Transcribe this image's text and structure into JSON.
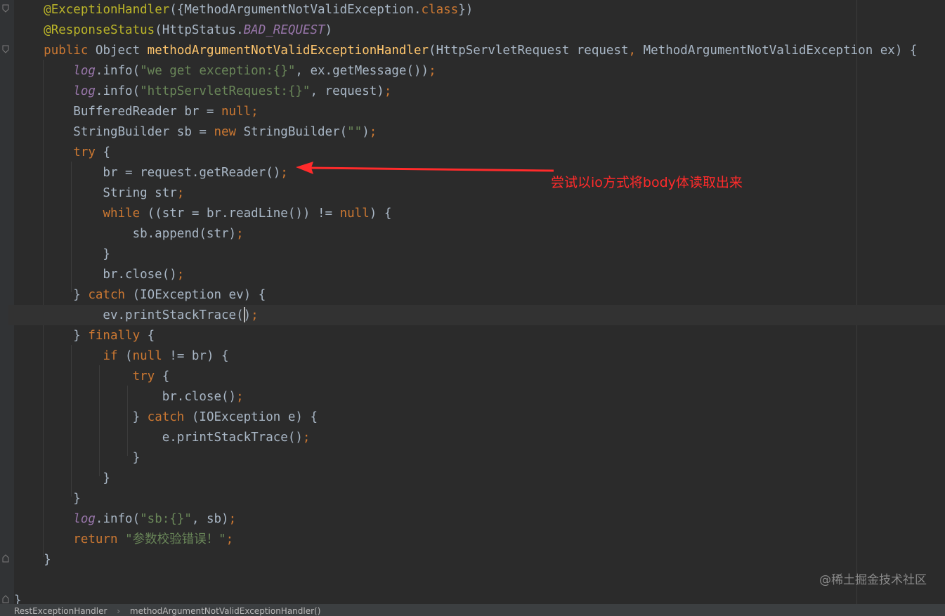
{
  "editor": {
    "lines": [
      [
        {
          "t": "    "
        },
        {
          "t": "@ExceptionHandler",
          "c": "annotation"
        },
        {
          "t": "({MethodArgumentNotValidException."
        },
        {
          "t": "class",
          "c": "keyword"
        },
        {
          "t": "})"
        }
      ],
      [
        {
          "t": "    "
        },
        {
          "t": "@ResponseStatus",
          "c": "annotation"
        },
        {
          "t": "(HttpStatus."
        },
        {
          "t": "BAD_REQUEST",
          "c": "static-field"
        },
        {
          "t": ")"
        }
      ],
      [
        {
          "t": "    "
        },
        {
          "t": "public",
          "c": "keyword"
        },
        {
          "t": " Object "
        },
        {
          "t": "methodArgumentNotValidExceptionHandler",
          "c": "method-decl"
        },
        {
          "t": "(HttpServletRequest request"
        },
        {
          "t": ",",
          "c": "punct"
        },
        {
          "t": " MethodArgumentNotValidException ex) {"
        }
      ],
      [
        {
          "t": "        "
        },
        {
          "t": "log",
          "c": "static-field"
        },
        {
          "t": ".info("
        },
        {
          "t": "\"we get exception:{}\"",
          "c": "string"
        },
        {
          "t": ","
        },
        {
          "t": " ex.getMessage())"
        },
        {
          "t": ";",
          "c": "punct"
        }
      ],
      [
        {
          "t": "        "
        },
        {
          "t": "log",
          "c": "static-field"
        },
        {
          "t": ".info("
        },
        {
          "t": "\"httpServletRequest:{}\"",
          "c": "string"
        },
        {
          "t": ","
        },
        {
          "t": " request)"
        },
        {
          "t": ";",
          "c": "punct"
        }
      ],
      [
        {
          "t": "        BufferedReader br = "
        },
        {
          "t": "null",
          "c": "keyword"
        },
        {
          "t": ";",
          "c": "punct"
        }
      ],
      [
        {
          "t": "        StringBuilder sb = "
        },
        {
          "t": "new",
          "c": "keyword"
        },
        {
          "t": " StringBuilder("
        },
        {
          "t": "\"\"",
          "c": "string"
        },
        {
          "t": ")"
        },
        {
          "t": ";",
          "c": "punct"
        }
      ],
      [
        {
          "t": "        "
        },
        {
          "t": "try",
          "c": "keyword"
        },
        {
          "t": " {"
        }
      ],
      [
        {
          "t": "            br = request.getReader()"
        },
        {
          "t": ";",
          "c": "punct"
        }
      ],
      [
        {
          "t": "            String str"
        },
        {
          "t": ";",
          "c": "punct"
        }
      ],
      [
        {
          "t": "            "
        },
        {
          "t": "while",
          "c": "keyword"
        },
        {
          "t": " ((str = br.readLine()) != "
        },
        {
          "t": "null",
          "c": "keyword"
        },
        {
          "t": ") {"
        }
      ],
      [
        {
          "t": "                sb.append(str)"
        },
        {
          "t": ";",
          "c": "punct"
        }
      ],
      [
        {
          "t": "            }"
        }
      ],
      [
        {
          "t": "            br.close()"
        },
        {
          "t": ";",
          "c": "punct"
        }
      ],
      [
        {
          "t": "        } "
        },
        {
          "t": "catch",
          "c": "keyword"
        },
        {
          "t": " (IOException ev) {"
        }
      ],
      [
        {
          "t": "            ev.printStackTrace()"
        },
        {
          "t": ";",
          "c": "punct"
        }
      ],
      [
        {
          "t": "        } "
        },
        {
          "t": "finally",
          "c": "keyword"
        },
        {
          "t": " {"
        }
      ],
      [
        {
          "t": "            "
        },
        {
          "t": "if",
          "c": "keyword"
        },
        {
          "t": " ("
        },
        {
          "t": "null",
          "c": "keyword"
        },
        {
          "t": " != br) {"
        }
      ],
      [
        {
          "t": "                "
        },
        {
          "t": "try",
          "c": "keyword"
        },
        {
          "t": " {"
        }
      ],
      [
        {
          "t": "                    br.close()"
        },
        {
          "t": ";",
          "c": "punct"
        }
      ],
      [
        {
          "t": "                } "
        },
        {
          "t": "catch",
          "c": "keyword"
        },
        {
          "t": " (IOException e) {"
        }
      ],
      [
        {
          "t": "                    e.printStackTrace()"
        },
        {
          "t": ";",
          "c": "punct"
        }
      ],
      [
        {
          "t": "                }"
        }
      ],
      [
        {
          "t": "            }"
        }
      ],
      [
        {
          "t": "        }"
        }
      ],
      [
        {
          "t": "        "
        },
        {
          "t": "log",
          "c": "static-field"
        },
        {
          "t": ".info("
        },
        {
          "t": "\"sb:{}\"",
          "c": "string"
        },
        {
          "t": ","
        },
        {
          "t": " sb)"
        },
        {
          "t": ";",
          "c": "punct"
        }
      ],
      [
        {
          "t": "        "
        },
        {
          "t": "return",
          "c": "keyword"
        },
        {
          "t": " "
        },
        {
          "t": "\"参数校验错误！\"",
          "c": "string"
        },
        {
          "t": ";",
          "c": "punct"
        }
      ],
      [
        {
          "t": "    }"
        }
      ],
      [
        {
          "t": ""
        }
      ],
      [
        {
          "t": "}"
        }
      ]
    ],
    "caret_line": 16
  },
  "annotation": {
    "text": "尝试以io方式将body体读取出来",
    "color": "#ff2b2b",
    "points_to_line": 9
  },
  "statusbar": {
    "crumbs": [
      "RestExceptionHandler",
      "methodArgumentNotValidExceptionHandler()"
    ],
    "separator": "›"
  },
  "watermark": "@稀土掘金技术社区",
  "theme": {
    "background": "#2b2b2b",
    "keyword": "#cc7832",
    "annotation": "#bbb529",
    "method": "#ffc66d",
    "string": "#6a8759",
    "static_field": "#9876aa",
    "default_text": "#a9b7c6"
  }
}
